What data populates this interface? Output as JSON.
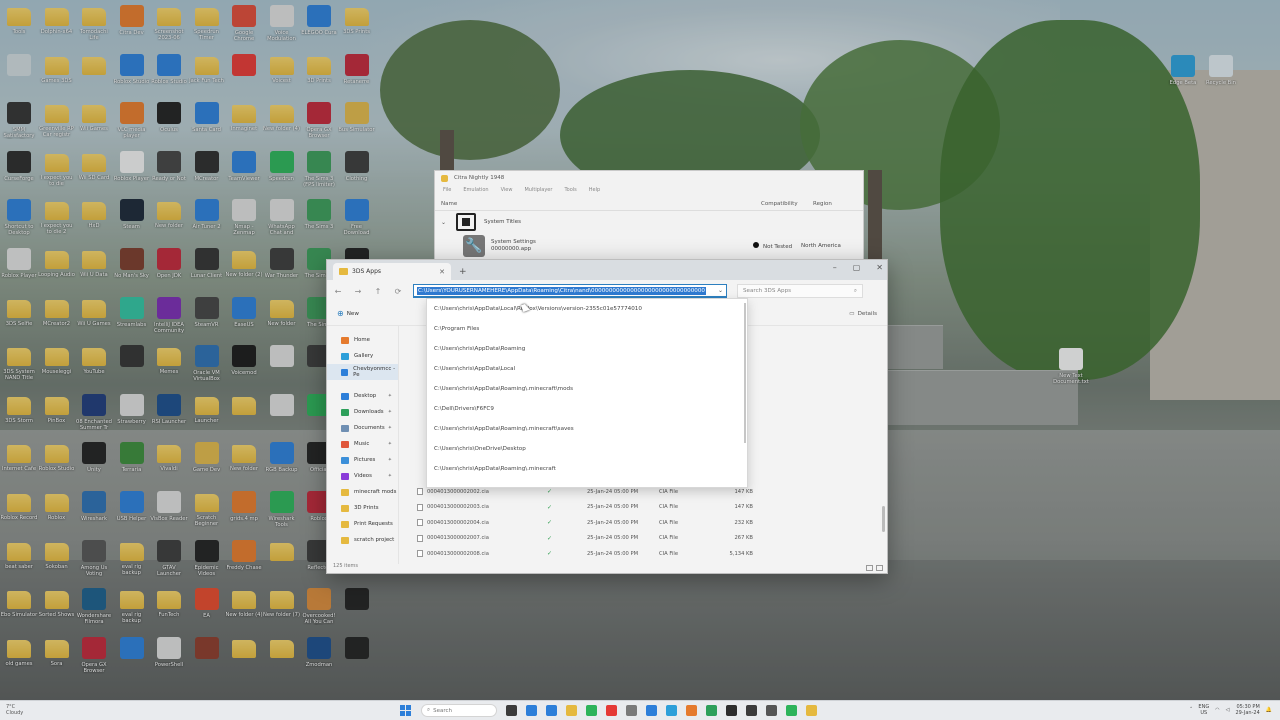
{
  "desktop": {
    "columns": [
      [
        {
          "label": "Tools",
          "type": "folder"
        },
        {
          "label": "",
          "type": "app",
          "color": "#cfd8dc"
        },
        {
          "label": "SMM Satisfactory Mod Man",
          "type": "app",
          "color": "#333333"
        },
        {
          "label": "CurseForge",
          "type": "app",
          "color": "#2b2b2b"
        },
        {
          "label": "Shortcut to Desktop",
          "type": "app",
          "color": "#2d7fd9"
        },
        {
          "label": "Roblox Player",
          "type": "app",
          "color": "#e0e0e0"
        },
        {
          "label": "3DS Selfie",
          "type": "folder"
        },
        {
          "label": "3DS System NAND Title",
          "type": "folder"
        },
        {
          "label": "3DS Storm",
          "type": "folder"
        },
        {
          "label": "Internet Cafe",
          "type": "folder"
        },
        {
          "label": "Roblox Record",
          "type": "folder"
        },
        {
          "label": "beat saber",
          "type": "folder"
        },
        {
          "label": "Ebo Simulator",
          "type": "folder"
        },
        {
          "label": "old games",
          "type": "folder"
        }
      ],
      [
        {
          "label": "Dolphin-x64",
          "type": "folder"
        },
        {
          "label": "Games 3DS",
          "type": "folder"
        },
        {
          "label": "Greenville RP Car registr",
          "type": "folder"
        },
        {
          "label": "I expect you to die",
          "type": "folder"
        },
        {
          "label": "I expect you to die 2",
          "type": "folder"
        },
        {
          "label": "Looping Audio",
          "type": "folder"
        },
        {
          "label": "MCreator2",
          "type": "folder"
        },
        {
          "label": "Mouseleggi",
          "type": "folder"
        },
        {
          "label": "PinBox",
          "type": "folder"
        },
        {
          "label": "Roblox Studio",
          "type": "folder"
        },
        {
          "label": "Roblox",
          "type": "folder"
        },
        {
          "label": "Sokoban",
          "type": "folder"
        },
        {
          "label": "Sorted Shows",
          "type": "folder"
        },
        {
          "label": "Sora",
          "type": "folder"
        }
      ],
      [
        {
          "label": "Tomodachi Life",
          "type": "folder"
        },
        {
          "label": "",
          "type": "folder"
        },
        {
          "label": "Wii Games",
          "type": "folder"
        },
        {
          "label": "Wii SD Card",
          "type": "folder"
        },
        {
          "label": "HxD",
          "type": "folder"
        },
        {
          "label": "Wii U Data",
          "type": "folder"
        },
        {
          "label": "Wii U Games",
          "type": "folder"
        },
        {
          "label": "YouTube",
          "type": "folder"
        },
        {
          "label": "08 Enchanted Summer Tr",
          "type": "app",
          "color": "#1f3b7a"
        },
        {
          "label": "Unity",
          "type": "app",
          "color": "#222222"
        },
        {
          "label": "Wireshark",
          "type": "app",
          "color": "#2d6fb3"
        },
        {
          "label": "Among Us Voting",
          "type": "app",
          "color": "#555555"
        },
        {
          "label": "Wondershare Filmora",
          "type": "app",
          "color": "#1c5e8c"
        },
        {
          "label": "Opera GX Browser",
          "type": "app",
          "color": "#c0283a"
        }
      ],
      [
        {
          "label": "Citra Dev",
          "type": "app",
          "color": "#e57a2d"
        },
        {
          "label": "Roblox Studio",
          "type": "app",
          "color": "#2d7fd9"
        },
        {
          "label": "VLC media player",
          "type": "app",
          "color": "#e57a2d"
        },
        {
          "label": "Roblox Player",
          "type": "app",
          "color": "#f0f0f0"
        },
        {
          "label": "Steam",
          "type": "app",
          "color": "#1b2838"
        },
        {
          "label": "No Man's Sky",
          "type": "app",
          "color": "#7a3b2b"
        },
        {
          "label": "Streamlabs",
          "type": "app",
          "color": "#31c3a2"
        },
        {
          "label": "",
          "type": "app",
          "color": "#333333"
        },
        {
          "label": "Strawberry",
          "type": "app",
          "color": "#dddddd"
        },
        {
          "label": "Terraria",
          "type": "app",
          "color": "#3b8c3b"
        },
        {
          "label": "USB Helper",
          "type": "app",
          "color": "#2d7fd9"
        },
        {
          "label": "eval rig backup",
          "type": "folder"
        },
        {
          "label": "eval rig backup",
          "type": "folder"
        },
        {
          "label": "",
          "type": "app",
          "color": "#2d7fd9"
        }
      ],
      [
        {
          "label": "Screenshot 2023-06",
          "type": "folder"
        },
        {
          "label": "Roblox Studio",
          "type": "app",
          "color": "#2d7fd9"
        },
        {
          "label": "Oculus",
          "type": "app",
          "color": "#222222"
        },
        {
          "label": "Ready or Not",
          "type": "app",
          "color": "#444444"
        },
        {
          "label": "New folder",
          "type": "folder"
        },
        {
          "label": "Open JDK",
          "type": "app",
          "color": "#c0283a"
        },
        {
          "label": "IntelliJ IDEA Community",
          "type": "app",
          "color": "#7a2db3"
        },
        {
          "label": "Memes",
          "type": "folder"
        },
        {
          "label": "RSI Launcher",
          "type": "app",
          "color": "#1c4e8c"
        },
        {
          "label": "Vivaldi",
          "type": "folder"
        },
        {
          "label": "VisBox Reader",
          "type": "app",
          "color": "#dddddd"
        },
        {
          "label": "GTAV Launcher",
          "type": "app",
          "color": "#3b3b3b"
        },
        {
          "label": "FunTech",
          "type": "folder"
        },
        {
          "label": "PowerShell",
          "type": "app",
          "color": "#dddddd"
        }
      ],
      [
        {
          "label": "Speedrun Timer",
          "type": "folder"
        },
        {
          "label": "Jack Fun Tech",
          "type": "folder"
        },
        {
          "label": "Santa Card",
          "type": "app",
          "color": "#2d7fd9"
        },
        {
          "label": "MCreator",
          "type": "app",
          "color": "#2d2d2d"
        },
        {
          "label": "Air Tuner 2",
          "type": "app",
          "color": "#2d7fd9"
        },
        {
          "label": "Lunar Client",
          "type": "app",
          "color": "#333333"
        },
        {
          "label": "SteamVR",
          "type": "app",
          "color": "#444444"
        },
        {
          "label": "Oracle VM VirtualBox",
          "type": "app",
          "color": "#2d6fb3"
        },
        {
          "label": "Launcher",
          "type": "folder"
        },
        {
          "label": "Game Dev",
          "type": "app",
          "color": "#e0b84b"
        },
        {
          "label": "Scratch Beginner",
          "type": "folder"
        },
        {
          "label": "Epidemic Videos",
          "type": "app",
          "color": "#222222"
        },
        {
          "label": "EA",
          "type": "app",
          "color": "#e54a2d"
        },
        {
          "label": "",
          "type": "app",
          "color": "#8c3b2b"
        }
      ],
      [
        {
          "label": "Google Chrome",
          "type": "app",
          "color": "#dd4b39"
        },
        {
          "label": "",
          "type": "app",
          "color": "#e53935"
        },
        {
          "label": "Inmaginet",
          "type": "folder"
        },
        {
          "label": "TeamViewer",
          "type": "app",
          "color": "#2d7fd9"
        },
        {
          "label": "Nmap - Zenmap",
          "type": "app",
          "color": "#dddddd"
        },
        {
          "label": "New folder (2)",
          "type": "folder"
        },
        {
          "label": "EaseUS",
          "type": "app",
          "color": "#2d7fd9"
        },
        {
          "label": "Voicemod",
          "type": "app",
          "color": "#1a1a1a"
        },
        {
          "label": "",
          "type": "folder"
        },
        {
          "label": "New folder",
          "type": "folder"
        },
        {
          "label": "grids.4 mp",
          "type": "app",
          "color": "#e57a2d"
        },
        {
          "label": "Freddy Chase",
          "type": "app",
          "color": "#e57a2d"
        },
        {
          "label": "New folder (4)",
          "type": "folder"
        },
        {
          "label": "",
          "type": "folder"
        }
      ],
      [
        {
          "label": "Voice Modulation",
          "type": "app",
          "color": "#dddddd"
        },
        {
          "label": "Voicest",
          "type": "folder"
        },
        {
          "label": "New folder (4)",
          "type": "folder"
        },
        {
          "label": "Speedrun",
          "type": "app",
          "color": "#2db35a"
        },
        {
          "label": "WhatsApp Chat and",
          "type": "app",
          "color": "#dddddd"
        },
        {
          "label": "War Thunder",
          "type": "app",
          "color": "#3b3b3b"
        },
        {
          "label": "New folder",
          "type": "folder"
        },
        {
          "label": "",
          "type": "app",
          "color": "#dddddd"
        },
        {
          "label": "",
          "type": "app",
          "color": "#dddddd"
        },
        {
          "label": "RGB Backup",
          "type": "app",
          "color": "#2d7fd9"
        },
        {
          "label": "Wireshark Tools",
          "type": "app",
          "color": "#2db35a"
        },
        {
          "label": "",
          "type": "folder"
        },
        {
          "label": "New folder (7)",
          "type": "folder"
        },
        {
          "label": "",
          "type": "folder"
        }
      ],
      [
        {
          "label": "ELEGOO Cura",
          "type": "app",
          "color": "#2d7fd9"
        },
        {
          "label": "3D Prints",
          "type": "folder"
        },
        {
          "label": "Opera GX Browser",
          "type": "app",
          "color": "#c0283a"
        },
        {
          "label": "The Sims 3 (FPS limiter)",
          "type": "app",
          "color": "#3b9c5a"
        },
        {
          "label": "The Sims 3",
          "type": "app",
          "color": "#3b9c5a"
        },
        {
          "label": "The Sims 4",
          "type": "app",
          "color": "#3b9c5a"
        },
        {
          "label": "The Sims",
          "type": "app",
          "color": "#3b9c5a"
        },
        {
          "label": "",
          "type": "app",
          "color": "#3b3b3b"
        },
        {
          "label": "",
          "type": "app",
          "color": "#2db35a"
        },
        {
          "label": "Official",
          "type": "app",
          "color": "#222222"
        },
        {
          "label": "Roblox",
          "type": "app",
          "color": "#c0283a"
        },
        {
          "label": "Reflector",
          "type": "app",
          "color": "#3b3b3b"
        },
        {
          "label": "Overcooked! All You Can Eat",
          "type": "app",
          "color": "#d88a3b"
        },
        {
          "label": "Zmodman",
          "type": "app",
          "color": "#1c4e8c"
        }
      ],
      [
        {
          "label": "3DS Prints",
          "type": "folder"
        },
        {
          "label": "Retanerre",
          "type": "app",
          "color": "#c0283a"
        },
        {
          "label": "Bus Simulator",
          "type": "app",
          "color": "#e0b84b"
        },
        {
          "label": "Clothing",
          "type": "app",
          "color": "#3b3b3b"
        },
        {
          "label": "Free Download",
          "type": "app",
          "color": "#2d7fd9"
        },
        {
          "label": "",
          "type": "app",
          "color": "#222222"
        },
        {
          "label": "",
          "type": "app",
          "color": "#222222"
        },
        {
          "label": "",
          "type": "app",
          "color": "#222222"
        },
        {
          "label": "",
          "type": "app",
          "color": "#222222"
        },
        {
          "label": "",
          "type": "app",
          "color": "#222222"
        },
        {
          "label": "",
          "type": "app",
          "color": "#222222"
        },
        {
          "label": "",
          "type": "app",
          "color": "#222222"
        },
        {
          "label": "",
          "type": "app",
          "color": "#222222"
        },
        {
          "label": "",
          "type": "app",
          "color": "#222222"
        }
      ]
    ],
    "right_icons": [
      {
        "label": "Edge Beta",
        "color": "#2d9fd9"
      },
      {
        "label": "Recycle Bin",
        "color": "#dfe8ee"
      },
      {
        "label": "New Text Document.txt",
        "color": "#f4f4f4"
      }
    ]
  },
  "citra": {
    "title": "Citra Nightly 1948",
    "menu": [
      "File",
      "Emulation",
      "View",
      "Multiplayer",
      "Tools",
      "Help"
    ],
    "col_name": "Name",
    "col_compat": "Compatibility",
    "col_region": "Region",
    "group_label": "System Titles",
    "item_title": "System Settings",
    "item_sub": "00000000.app",
    "item_status": "Not Tested",
    "item_region": "North America"
  },
  "explorer": {
    "tab_label": "3DS Apps",
    "address": "C:\\Users\\YOURUSERNAMEHERE\\AppData\\Roaming\\Citra\\nand\\00000000000000000000000000000000",
    "search_placeholder": "Search 3DS Apps",
    "new_label": "New",
    "details_label": "Details",
    "sidebar": [
      {
        "label": "Home",
        "color": "#e57a2d"
      },
      {
        "label": "Gallery",
        "color": "#2d9fd9"
      },
      {
        "label": "Chevbyonmcc - Pe",
        "color": "#2d7fd9"
      },
      {
        "label": "Desktop",
        "color": "#2d7fd9"
      },
      {
        "label": "Downloads",
        "color": "#2d9f5a"
      },
      {
        "label": "Documents",
        "color": "#6f8fb3"
      },
      {
        "label": "Music",
        "color": "#e0573b"
      },
      {
        "label": "Pictures",
        "color": "#3b8fd9"
      },
      {
        "label": "Videos",
        "color": "#8a3bd9"
      },
      {
        "label": "minecraft mods",
        "color": "#e5b93f"
      },
      {
        "label": "3D Prints",
        "color": "#e5b93f"
      },
      {
        "label": "Print Requests",
        "color": "#e5b93f"
      },
      {
        "label": "scratch project",
        "color": "#e5b93f"
      }
    ],
    "files": [
      {
        "name": "0004013000002002.cia",
        "date": "25-Jan-24 05:00 PM",
        "type": "CIA File",
        "size": "147 KB"
      },
      {
        "name": "0004013000002003.cia",
        "date": "25-Jan-24 05:00 PM",
        "type": "CIA File",
        "size": "147 KB"
      },
      {
        "name": "0004013000002004.cia",
        "date": "25-Jan-24 05:00 PM",
        "type": "CIA File",
        "size": "232 KB"
      },
      {
        "name": "0004013000002007.cia",
        "date": "25-Jan-24 05:00 PM",
        "type": "CIA File",
        "size": "267 KB"
      },
      {
        "name": "0004013000002008.cia",
        "date": "25-Jan-24 05:00 PM",
        "type": "CIA File",
        "size": "5,134 KB"
      }
    ],
    "status": "125 items"
  },
  "address_history": [
    "C:\\Users\\chris\\AppData\\Local\\Roblox\\Versions\\version-2355c01e57774010",
    "C:\\Program Files",
    "C:\\Users\\chris\\AppData\\Roaming",
    "C:\\Users\\chris\\AppData\\Local",
    "C:\\Users\\chris\\AppData\\Roaming\\.minecraft\\mods",
    "C:\\Dell\\Drivers\\F6FC9",
    "C:\\Users\\chris\\AppData\\Roaming\\.minecraft\\saves",
    "C:\\Users\\chris\\OneDrive\\Desktop",
    "C:\\Users\\chris\\AppData\\Roaming\\.minecraft"
  ],
  "taskbar": {
    "weather_temp": "7°C",
    "weather_desc": "Cloudy",
    "search_label": "Search",
    "apps": [
      "#3b3b3b",
      "#2d7fd9",
      "#2d7fd9",
      "#e5b93f",
      "#2db35a",
      "#e53935",
      "#7a7a7a",
      "#2d7fd9",
      "#2d9fd9",
      "#e57a2d",
      "#2d9f5a",
      "#2d2d2d",
      "#3b3b3b",
      "#555555",
      "#2db35a",
      "#e5b93f"
    ],
    "lang_top": "ENG",
    "lang_bottom": "US",
    "time": "05:30 PM",
    "date": "29-Jan-24"
  }
}
